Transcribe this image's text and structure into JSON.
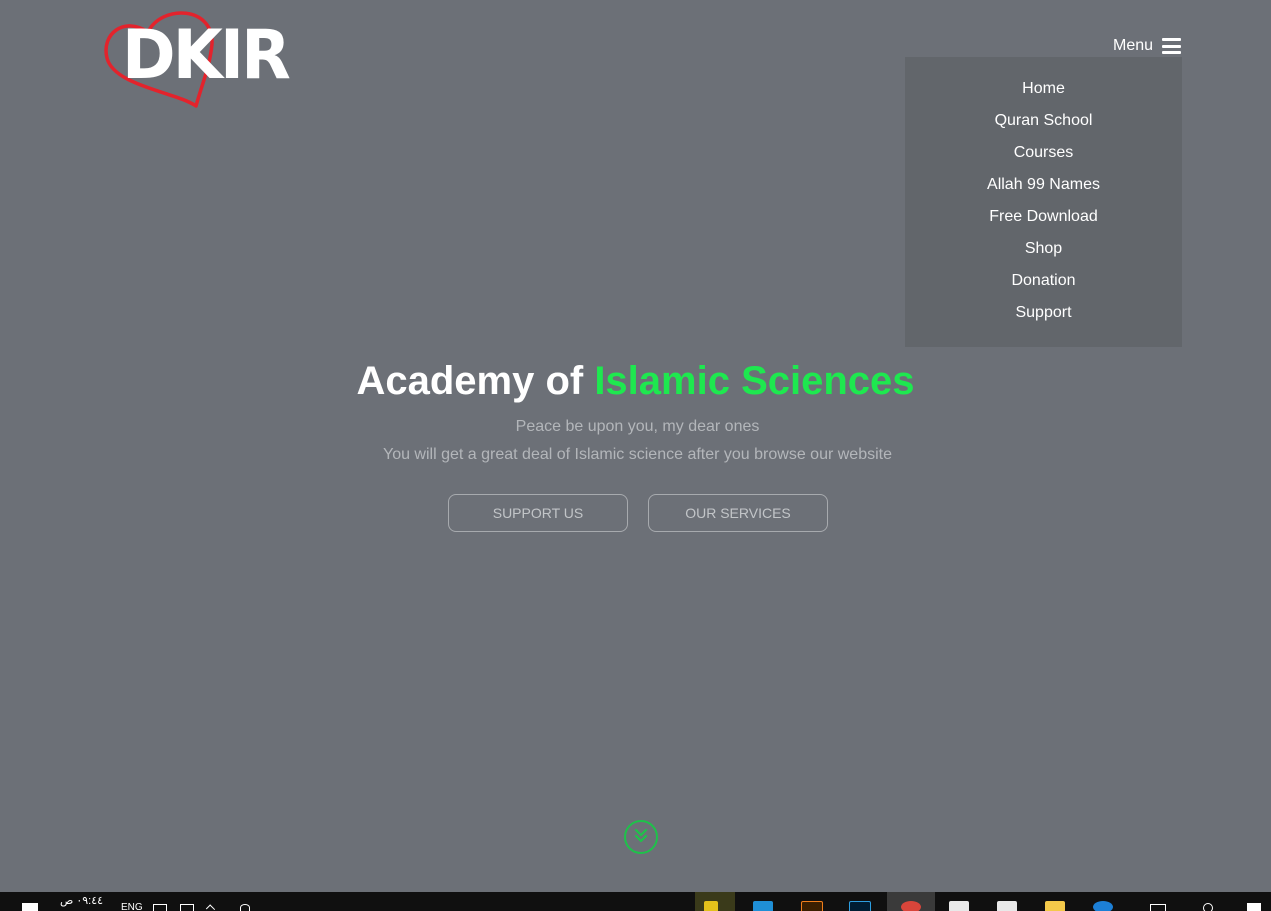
{
  "header": {
    "logo_text": "DKIR",
    "menu_label": "Menu"
  },
  "nav": {
    "items": [
      {
        "label": "Home"
      },
      {
        "label": "Quran School"
      },
      {
        "label": "Courses"
      },
      {
        "label": "Allah 99 Names"
      },
      {
        "label": "Free Download"
      },
      {
        "label": "Shop"
      },
      {
        "label": "Donation"
      },
      {
        "label": "Support"
      }
    ]
  },
  "hero": {
    "title_part1": "Academy of ",
    "title_accent": "Islamic Sciences",
    "line1": "Peace be upon you, my dear ones",
    "line2": "You will get a great deal of Islamic science after you browse our website",
    "support_button": "SUPPORT US",
    "services_button": "OUR SERVICES"
  },
  "taskbar": {
    "clock": "٠٩:٤٤ ص",
    "language": "ENG",
    "apps": [
      {
        "name": "sticky-notes-icon",
        "color": "#e3c11b"
      },
      {
        "name": "snipping-tool-icon",
        "color": "#1f8fd6"
      },
      {
        "name": "illustrator-icon",
        "color": "#f07e1b"
      },
      {
        "name": "photoshop-icon",
        "color": "#2d9ee0"
      },
      {
        "name": "chrome-icon",
        "color": "#d9453a"
      },
      {
        "name": "mail-icon",
        "color": "#e9e9e9"
      },
      {
        "name": "store-icon",
        "color": "#e9e9e9"
      },
      {
        "name": "file-explorer-icon",
        "color": "#f4c94a"
      },
      {
        "name": "edge-icon",
        "color": "#1c7fd6"
      }
    ]
  },
  "colors": {
    "background": "#6c7077",
    "dropdown": "#62666b",
    "accent_green": "#1ee84f",
    "logo_heart": "#e3232c"
  }
}
